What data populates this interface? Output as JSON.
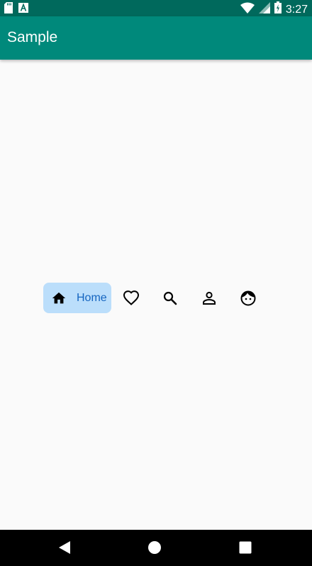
{
  "status_bar": {
    "time": "3:27",
    "left_icons": [
      "sd-card-icon",
      "a-notification-icon"
    ],
    "right_icons": [
      "wifi-icon",
      "signal-icon",
      "battery-icon"
    ]
  },
  "app_bar": {
    "title": "Sample"
  },
  "bottom_navigation": {
    "selected_index": 0,
    "items": [
      {
        "icon": "home-icon",
        "label": "Home",
        "selected": true
      },
      {
        "icon": "heart-icon",
        "label": "",
        "selected": false
      },
      {
        "icon": "search-icon",
        "label": "",
        "selected": false
      },
      {
        "icon": "person-icon",
        "label": "",
        "selected": false
      },
      {
        "icon": "face-icon",
        "label": "",
        "selected": false
      }
    ]
  },
  "system_nav": {
    "buttons": [
      "back-icon",
      "home-circle-icon",
      "recents-icon"
    ]
  },
  "colors": {
    "status_bar": "#00695c",
    "app_bar": "#00897b",
    "selected_pill": "#bbdefb",
    "selected_label": "#1565c0",
    "background": "#fafafa"
  }
}
